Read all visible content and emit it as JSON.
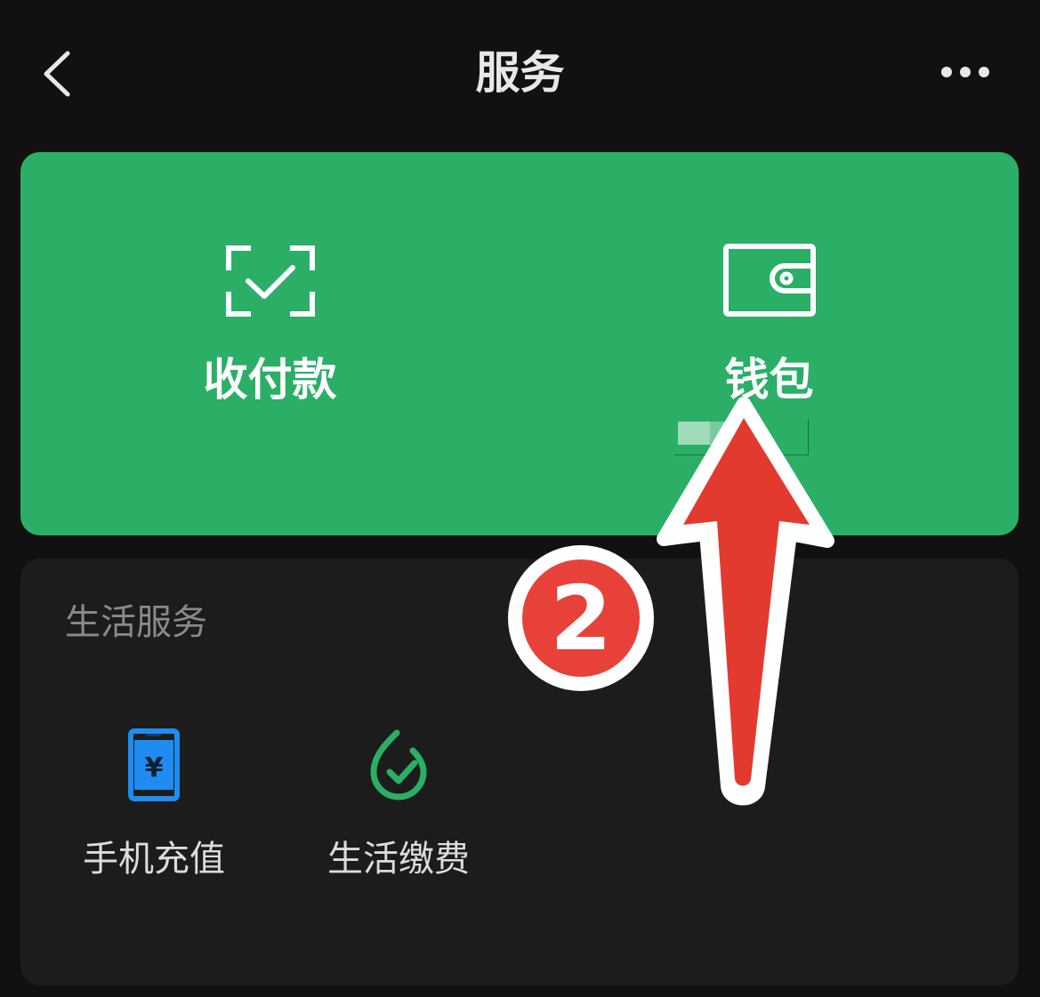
{
  "header": {
    "title": "服务",
    "back_icon": "chevron-left-icon",
    "more_icon": "more-horizontal-icon"
  },
  "main_card": {
    "background_color": "#2baf67",
    "items": [
      {
        "label": "收付款",
        "icon": "scan-check-icon"
      },
      {
        "label": "钱包",
        "icon": "wallet-icon"
      }
    ]
  },
  "life_services": {
    "title": "生活服务",
    "items": [
      {
        "label": "手机充值",
        "icon": "phone-recharge-icon",
        "icon_color": "#1e8cf0"
      },
      {
        "label": "生活缴费",
        "icon": "utility-payment-icon",
        "icon_color": "#2baf67"
      }
    ]
  },
  "annotation": {
    "step_number": "2",
    "badge_color": "#e8413a",
    "arrow_color": "#e33a2f"
  }
}
